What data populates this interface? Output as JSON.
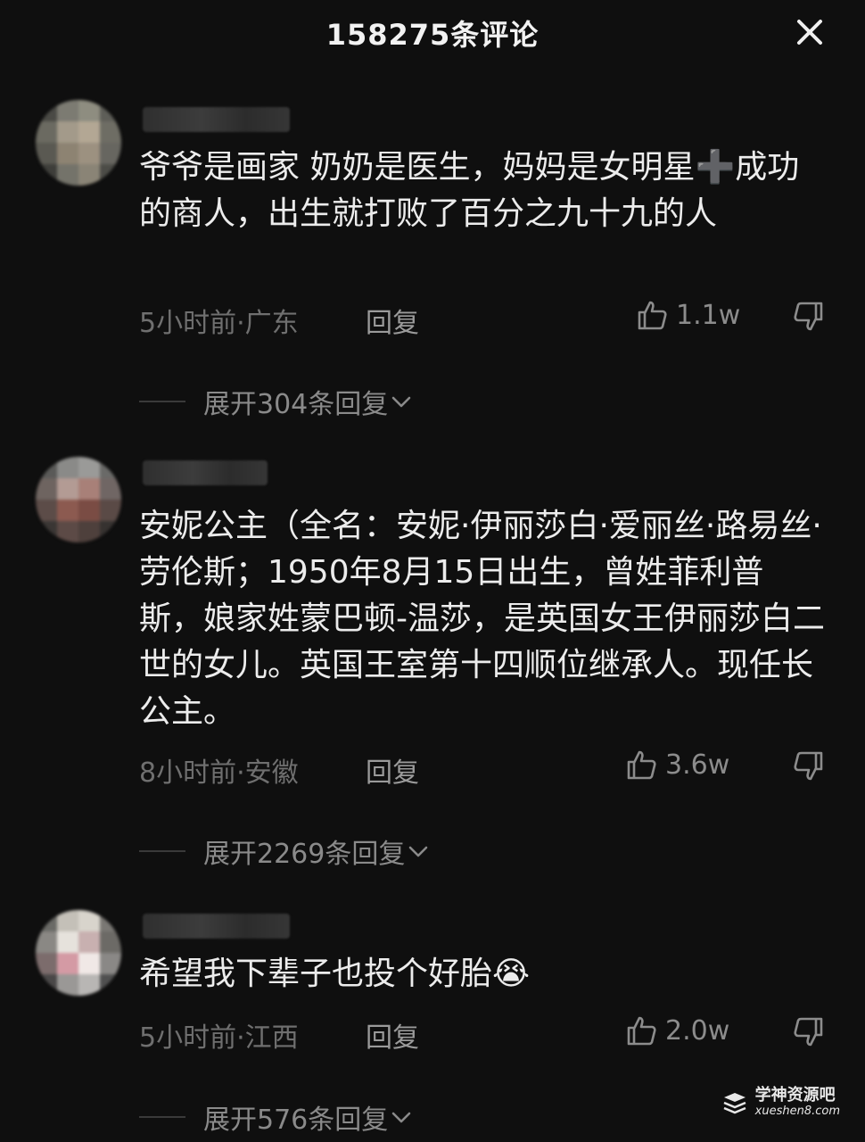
{
  "header": {
    "title": "158275条评论"
  },
  "comments": [
    {
      "text": "爷爷是画家 奶奶是医生，妈妈是女明星➕成功的商人，出生就打败了百分之九十九的人",
      "time_location": "5小时前·广东",
      "reply_label": "回复",
      "likes": "1.1w",
      "expand_label": "展开304条回复"
    },
    {
      "text": "安妮公主（全名：安妮·伊丽莎白·爱丽丝·路易丝·劳伦斯；1950年8月15日出生，曾姓菲利普斯，娘家姓蒙巴顿-温莎，是英国女王伊丽莎白二世的女儿。英国王室第十四顺位继承人。现任长公主。",
      "time_location": "8小时前·安徽",
      "reply_label": "回复",
      "likes": "3.6w",
      "expand_label": "展开2269条回复"
    },
    {
      "text": "希望我下辈子也投个好胎😭",
      "time_location": "5小时前·江西",
      "reply_label": "回复",
      "likes": "2.0w",
      "expand_label": "展开576条回复"
    }
  ],
  "watermark": {
    "name": "学神资源吧",
    "url": "xueshen8.com"
  },
  "icons": {
    "close": "close-icon",
    "like": "thumbs-up-icon",
    "dislike": "thumbs-down-icon",
    "expand": "chevron-down-icon"
  }
}
